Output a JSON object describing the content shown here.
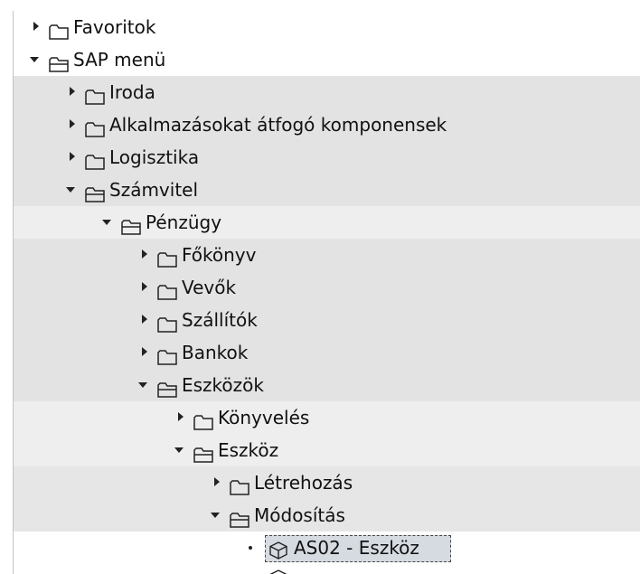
{
  "tree": {
    "rows": [
      {
        "label": "Favoritok",
        "expanded": false
      },
      {
        "label": "SAP menü",
        "expanded": true
      },
      {
        "label": "Iroda",
        "expanded": false
      },
      {
        "label": "Alkalmazásokat átfogó komponensek",
        "expanded": false
      },
      {
        "label": "Logisztika",
        "expanded": false
      },
      {
        "label": "Számvitel",
        "expanded": true
      },
      {
        "label": "Pénzügy",
        "expanded": true
      },
      {
        "label": "Főkönyv",
        "expanded": false
      },
      {
        "label": "Vevők",
        "expanded": false
      },
      {
        "label": "Szállítók",
        "expanded": false
      },
      {
        "label": "Bankok",
        "expanded": false
      },
      {
        "label": "Eszközök",
        "expanded": true
      },
      {
        "label": "Könyvelés",
        "expanded": false
      },
      {
        "label": "Eszköz",
        "expanded": true
      },
      {
        "label": "Létrehozás",
        "expanded": false
      },
      {
        "label": "Módosítás",
        "expanded": true
      },
      {
        "label": "AS02 - Eszköz",
        "type": "transaction",
        "selected": true
      }
    ]
  },
  "colors": {
    "band_white": "#ffffff",
    "band_gray": "#e3e3e3",
    "band_light": "#eeeeee",
    "text": "#111111",
    "selection": "#d6dbe2"
  }
}
